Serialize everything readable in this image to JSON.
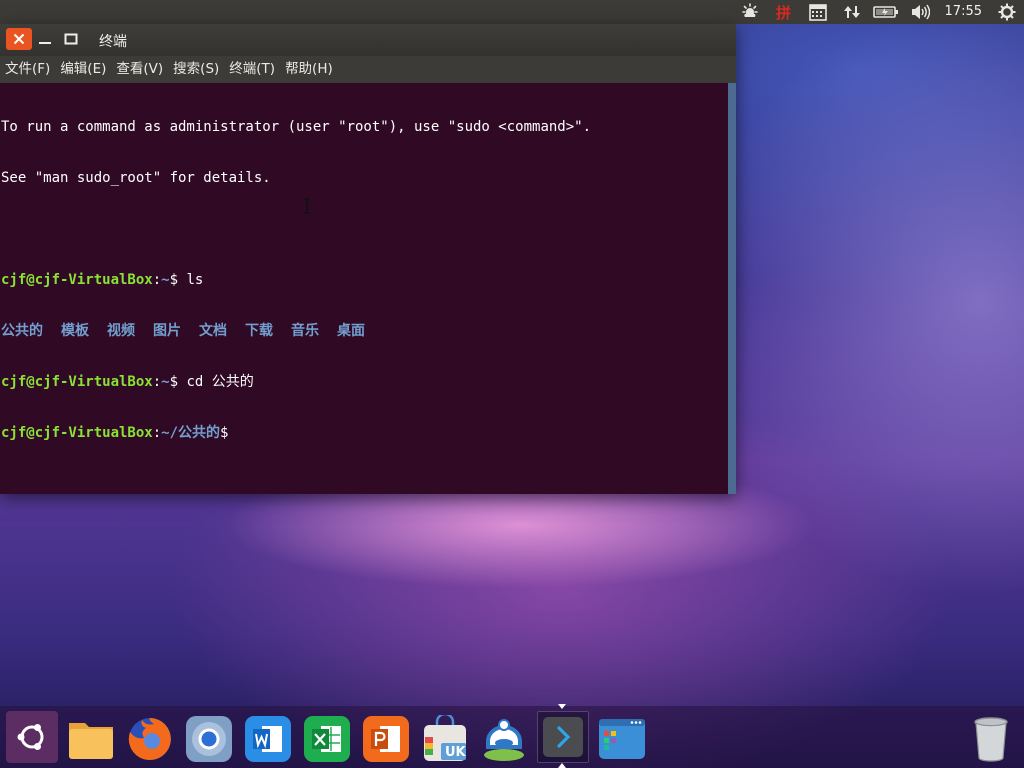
{
  "top_panel": {
    "clock": "17:55",
    "input_method_label": "拼",
    "tray_icons": [
      "weather-icon",
      "input-method-icon",
      "calendar-icon",
      "network-icon",
      "battery-icon",
      "volume-icon",
      "settings-gear-icon"
    ]
  },
  "terminal": {
    "title": "终端",
    "menu": [
      "文件(F)",
      "编辑(E)",
      "查看(V)",
      "搜索(S)",
      "终端(T)",
      "帮助(H)"
    ],
    "motd": [
      "To run a command as administrator (user \"root\"), use \"sudo <command>\".",
      "See \"man sudo_root\" for details."
    ],
    "prompt_user": "cjf@cjf-VirtualBox",
    "prompt_sep": ":",
    "line1": {
      "path": "~",
      "dollar": "$ ",
      "cmd": "ls"
    },
    "ls_output": [
      "公共的",
      "模板",
      "视频",
      "图片",
      "文档",
      "下载",
      "音乐",
      "桌面"
    ],
    "line2": {
      "path": "~",
      "dollar": "$ ",
      "cmd": "cd 公共的"
    },
    "line3": {
      "path": "~/公共的",
      "dollar": "$",
      "cmd": ""
    }
  },
  "dock": {
    "items": [
      {
        "name": "ubuntu-logo-icon"
      },
      {
        "name": "files-folder-icon"
      },
      {
        "name": "firefox-icon"
      },
      {
        "name": "chromium-icon"
      },
      {
        "name": "wps-writer-icon"
      },
      {
        "name": "wps-spreadsheets-icon"
      },
      {
        "name": "wps-presentation-icon"
      },
      {
        "name": "software-center-icon",
        "badge": "UK"
      },
      {
        "name": "system-helper-icon"
      },
      {
        "name": "terminal-icon",
        "active": true
      },
      {
        "name": "workspace-switcher-icon"
      }
    ],
    "trash": {
      "name": "trash-icon"
    }
  },
  "colors": {
    "terminal_bg": "#300a24",
    "prompt_green": "#8ae234",
    "prompt_blue": "#729fcf",
    "close_orange": "#e95420",
    "panel_bg": "#3c3b37"
  }
}
